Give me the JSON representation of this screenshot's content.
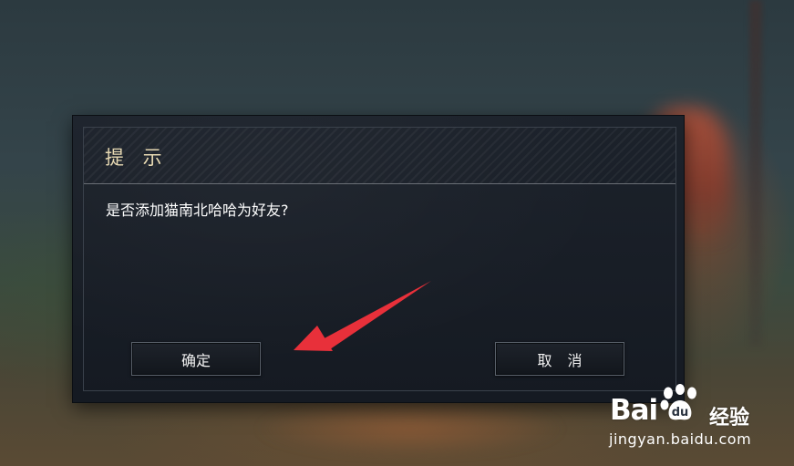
{
  "dialog": {
    "title": "提 示",
    "message": "是否添加猫南北哈哈为好友?",
    "confirm_label": "确定",
    "cancel_label": "取 消"
  },
  "annotation": {
    "arrow_color": "#e8303a"
  },
  "watermark": {
    "brand_left": "Bai",
    "brand_right": "du",
    "brand_cn": "经验",
    "url": "jingyan.baidu.com"
  },
  "colors": {
    "title_text": "#e6d8b2",
    "dialog_bg": "#171c24"
  }
}
